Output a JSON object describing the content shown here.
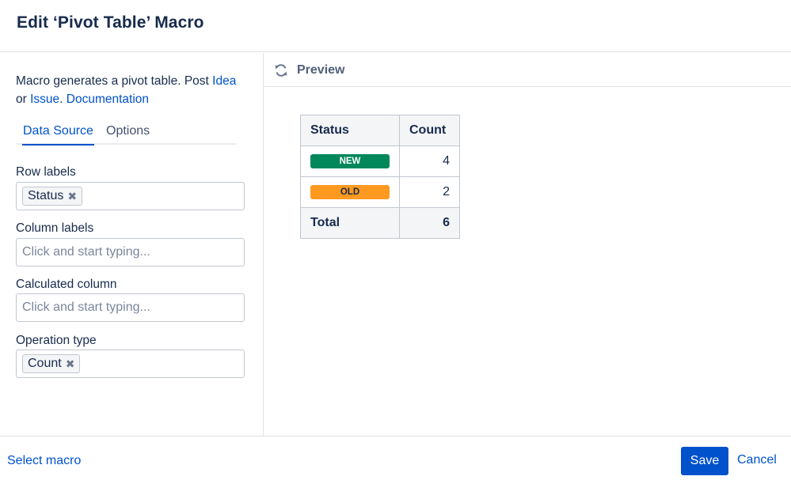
{
  "dialog": {
    "title": "Edit ‘Pivot Table’ Macro"
  },
  "description": {
    "text_before": "Macro generates a pivot table. Post ",
    "idea_link": "Idea",
    "or_text": "or ",
    "issue_link": "Issue",
    "period": ".",
    "docs_link": "Documentation"
  },
  "tabs": [
    {
      "label": "Data Source",
      "active": true
    },
    {
      "label": "Options",
      "active": false
    }
  ],
  "fields": {
    "row_labels": {
      "label": "Row labels",
      "chips": [
        "Status"
      ]
    },
    "column_labels": {
      "label": "Column labels",
      "placeholder": "Click and start typing..."
    },
    "calculated_column": {
      "label": "Calculated column",
      "placeholder": "Click and start typing..."
    },
    "operation_type": {
      "label": "Operation type",
      "chips": [
        "Count"
      ]
    }
  },
  "preview": {
    "title": "Preview",
    "table": {
      "headers": [
        "Status",
        "Count"
      ],
      "rows": [
        {
          "status": "NEW",
          "count": "4",
          "color": "#00875a"
        },
        {
          "status": "OLD",
          "count": "2",
          "color": "#ff991f"
        }
      ],
      "total": {
        "label": "Total",
        "count": "6"
      }
    }
  },
  "footer": {
    "select_macro": "Select macro",
    "save": "Save",
    "cancel": "Cancel"
  },
  "colors": {
    "primary": "#0052cc",
    "border": "#dfe1e6"
  },
  "icons": {
    "chip_remove": "close-icon",
    "preview": "refresh-icon"
  }
}
